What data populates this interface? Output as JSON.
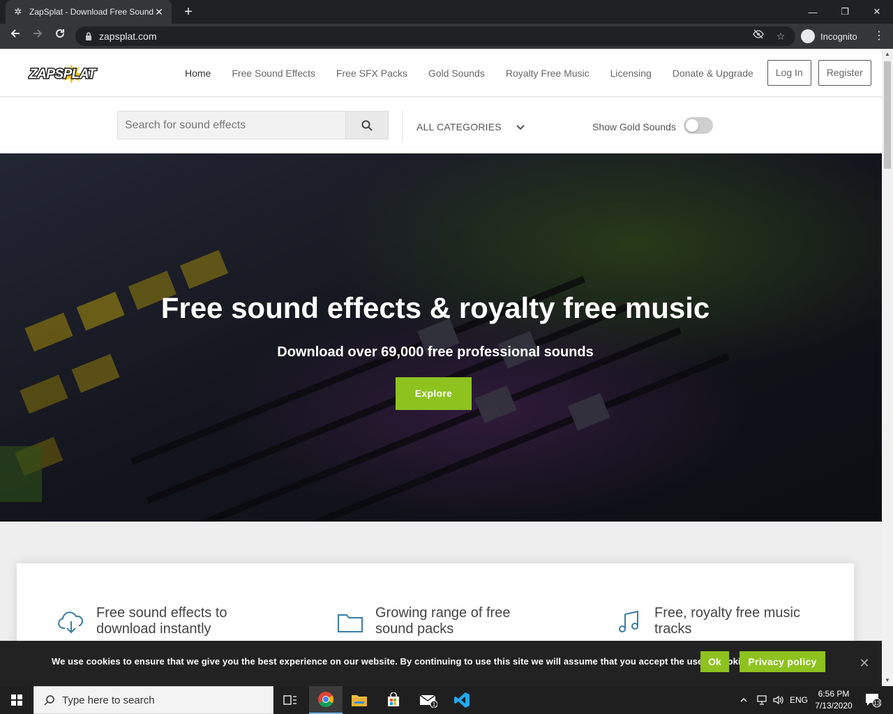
{
  "browser": {
    "tab_title": "ZapSplat - Download Free Sound",
    "tab_close": "✕",
    "new_tab": "+",
    "url": "zapsplat.com",
    "incognito_label": "Incognito",
    "window_minimize": "—",
    "window_restore": "❐",
    "window_close": "✕"
  },
  "site": {
    "logo_text": "ZAPSPLAT",
    "nav": [
      {
        "label": "Home"
      },
      {
        "label": "Free Sound Effects"
      },
      {
        "label": "Free SFX Packs"
      },
      {
        "label": "Gold Sounds"
      },
      {
        "label": "Royalty Free Music"
      },
      {
        "label": "Licensing"
      },
      {
        "label": "Donate & Upgrade"
      }
    ],
    "login_label": "Log In",
    "register_label": "Register",
    "search": {
      "placeholder": "Search for sound effects",
      "categories_label": "ALL CATEGORIES",
      "gold_toggle_label": "Show Gold Sounds",
      "gold_toggle_on": false
    },
    "hero": {
      "title": "Free sound effects & royalty free music",
      "subtitle": "Download over 69,000 free professional sounds",
      "button_label": "Explore"
    },
    "features": [
      {
        "icon": "cloud-download-icon",
        "text": "Free sound effects to download instantly"
      },
      {
        "icon": "folder-icon",
        "text": "Growing range of free sound packs"
      },
      {
        "icon": "music-note-icon",
        "text": "Free, royalty free music tracks"
      }
    ],
    "cookie": {
      "message": "We use cookies to ensure that we give you the best experience on our website. By continuing to use this site we will assume that you accept the use of cookies.",
      "ok_label": "Ok",
      "privacy_label": "Privacy policy",
      "close": "✕"
    },
    "colors": {
      "accent_green": "#8dc21f",
      "logo_yellow": "#f5c518",
      "icon_blue": "#3a7ca5"
    }
  },
  "taskbar": {
    "search_text": "Type here to search",
    "language": "ENG",
    "time": "6:56 PM",
    "date": "7/13/2020",
    "notifications_count": "13",
    "mail_badge": "1"
  }
}
